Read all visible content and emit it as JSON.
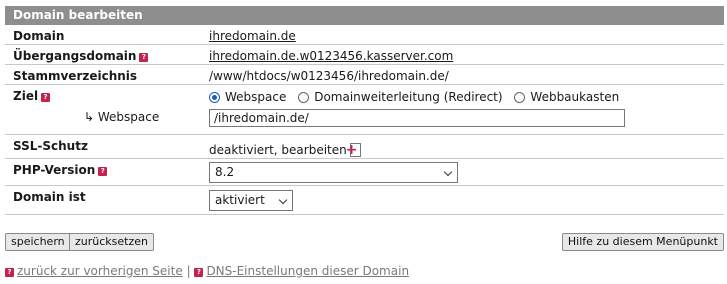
{
  "panel": {
    "title": "Domain bearbeiten"
  },
  "rows": {
    "domain": {
      "label": "Domain",
      "value": "ihredomain.de"
    },
    "uebergang": {
      "label": "Übergangsdomain",
      "value": "ihredomain.de.w0123456.kasserver.com"
    },
    "stamm": {
      "label": "Stammverzeichnis",
      "value": "/www/htdocs/w0123456/ihredomain.de/"
    },
    "ziel": {
      "label": "Ziel",
      "options": [
        "Webspace",
        "Domainweiterleitung (Redirect)",
        "Webbaukasten"
      ],
      "selected": "Webspace",
      "sub_label": "↳ Webspace",
      "sub_value": "/ihredomain.de/"
    },
    "ssl": {
      "label": "SSL-Schutz",
      "value": "deaktiviert, bearbeiten"
    },
    "php": {
      "label": "PHP-Version",
      "value": "8.2"
    },
    "status": {
      "label": "Domain ist",
      "value": "aktiviert"
    }
  },
  "buttons": {
    "save": "speichern",
    "reset": "zurücksetzen",
    "help": "Hilfe zu diesem Menüpunkt"
  },
  "footer": {
    "back": "zurück zur vorherigen Seite",
    "separator": "|",
    "dns": "DNS-Einstellungen dieser Domain"
  },
  "icons": {
    "help": "question-icon",
    "add": "add-page-icon"
  },
  "colors": {
    "header": "#8e8e8e",
    "icon": "#c4234f",
    "radio": "#1a5cc4"
  }
}
